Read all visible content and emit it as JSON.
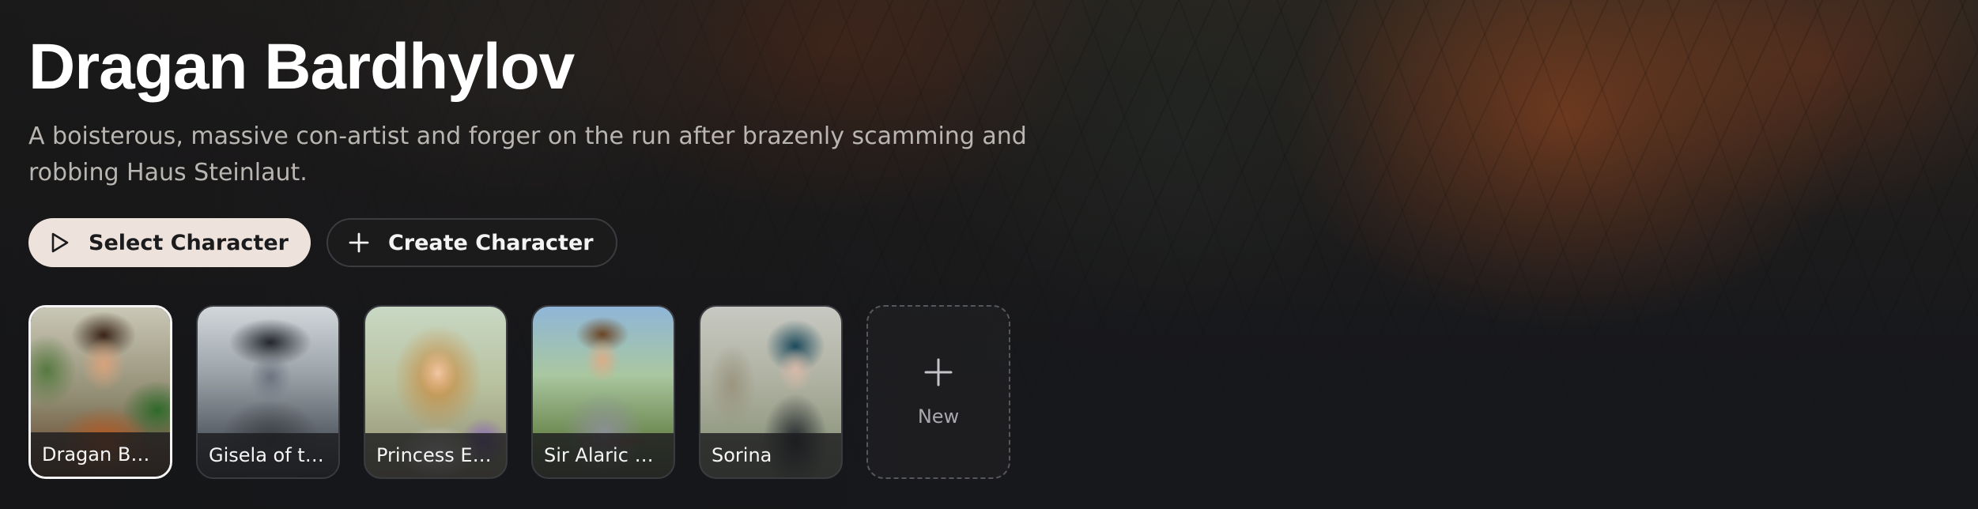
{
  "character": {
    "name": "Dragan Bardhylov",
    "description": "A boisterous, massive con-artist and forger on the run after brazenly scamming and robbing Haus Steinlaut."
  },
  "actions": {
    "select_label": "Select Character",
    "select_icon": "play-icon",
    "create_label": "Create Character",
    "create_icon": "plus-icon"
  },
  "characters": [
    {
      "label": "Dragan Bar...",
      "selected": true
    },
    {
      "label": "Gisela of th...",
      "selected": false
    },
    {
      "label": "Princess Ela...",
      "selected": false
    },
    {
      "label": "Sir Alaric R...",
      "selected": false
    },
    {
      "label": "Sorina",
      "selected": false
    }
  ],
  "new_card": {
    "label": "New",
    "icon": "plus-icon"
  },
  "colors": {
    "primary_button_bg": "#ede3dc",
    "background": "#17181c",
    "selected_border": "#f4f4f4"
  }
}
